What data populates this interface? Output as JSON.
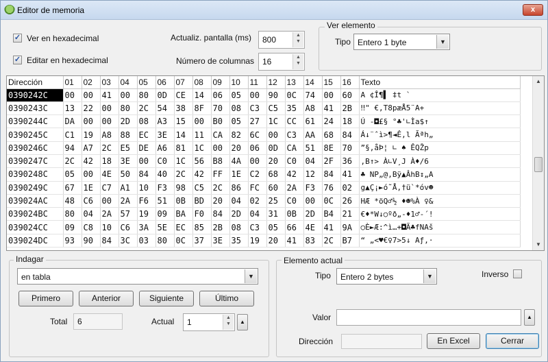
{
  "window": {
    "title": "Editor de memoria",
    "close": "x"
  },
  "options": {
    "hex_view_label": "Ver en hexadecimal",
    "hex_view_checked": true,
    "hex_edit_label": "Editar en hexadecimal",
    "hex_edit_checked": true,
    "refresh_label": "Actualiz. pantalla (ms)",
    "refresh_value": "800",
    "columns_label": "Número de columnas",
    "columns_value": "16"
  },
  "view_element": {
    "title": "Ver elemento",
    "type_label": "Tipo",
    "type_value": "Entero 1 byte"
  },
  "grid": {
    "headers": [
      "Dirección",
      "01",
      "02",
      "03",
      "04",
      "05",
      "06",
      "07",
      "08",
      "09",
      "10",
      "11",
      "12",
      "13",
      "14",
      "15",
      "16",
      "Texto"
    ],
    "rows": [
      {
        "addr": "0390242C",
        "bytes": [
          "00",
          "00",
          "41",
          "00",
          "80",
          "0D",
          "CE",
          "14",
          "06",
          "05",
          "00",
          "90",
          "0C",
          "74",
          "00",
          "60"
        ],
        "text": "  A ¢Î¶▌ ‡t `"
      },
      {
        "addr": "0390243C",
        "bytes": [
          "13",
          "22",
          "00",
          "80",
          "2C",
          "54",
          "38",
          "8F",
          "70",
          "08",
          "C3",
          "C5",
          "35",
          "A8",
          "41",
          "2B"
        ],
        "text": "‼\" €,T8pæÅ5¨A+"
      },
      {
        "addr": "0390244C",
        "bytes": [
          "DA",
          "00",
          "00",
          "2D",
          "08",
          "A3",
          "15",
          "00",
          "B0",
          "05",
          "27",
          "1C",
          "CC",
          "61",
          "24",
          "18"
        ],
        "text": "Ú  -◘£§ °♣'∟Ìa$↑"
      },
      {
        "addr": "0390245C",
        "bytes": [
          "C1",
          "19",
          "A8",
          "88",
          "EC",
          "3E",
          "14",
          "11",
          "CA",
          "82",
          "6C",
          "00",
          "C3",
          "AA",
          "68",
          "84"
        ],
        "text": "Á↓¨ˆì>¶◄Ê‚l Ãªh„"
      },
      {
        "addr": "0390246C",
        "bytes": [
          "94",
          "A7",
          "2C",
          "E5",
          "DE",
          "A6",
          "81",
          "1C",
          "00",
          "20",
          "06",
          "0D",
          "CA",
          "51",
          "8E",
          "70"
        ],
        "text": "”§,åÞ¦ ∟  ♠ ÊQŽp"
      },
      {
        "addr": "0390247C",
        "bytes": [
          "2C",
          "42",
          "18",
          "3E",
          "00",
          "C0",
          "1C",
          "56",
          "B8",
          "4A",
          "00",
          "20",
          "C0",
          "04",
          "2F",
          "36"
        ],
        "text": ",B↑> À∟V¸J  À♦/6"
      },
      {
        "addr": "0390248C",
        "bytes": [
          "05",
          "00",
          "4E",
          "50",
          "84",
          "40",
          "2C",
          "42",
          "FF",
          "1E",
          "C2",
          "68",
          "42",
          "12",
          "84",
          "41"
        ],
        "text": "♣ NP„@,Bÿ▲ÂhB↕„A"
      },
      {
        "addr": "0390249C",
        "bytes": [
          "67",
          "1E",
          "C7",
          "A1",
          "10",
          "F3",
          "98",
          "C5",
          "2C",
          "86",
          "FC",
          "60",
          "2A",
          "F3",
          "76",
          "02"
        ],
        "text": "g▲Ç¡►ó˜Å,†ü`*óv☻"
      },
      {
        "addr": "039024AC",
        "bytes": [
          "48",
          "C6",
          "00",
          "2A",
          "F6",
          "51",
          "0B",
          "BD",
          "20",
          "04",
          "02",
          "25",
          "C0",
          "00",
          "0C",
          "26"
        ],
        "text": "HÆ *öQ♂½ ♦☻%À ♀&"
      },
      {
        "addr": "039024BC",
        "bytes": [
          "80",
          "04",
          "2A",
          "57",
          "19",
          "09",
          "BA",
          "F0",
          "84",
          "2D",
          "04",
          "31",
          "0B",
          "2D",
          "B4",
          "21"
        ],
        "text": "€♦*W↓○ºð„-♦1♂-´!"
      },
      {
        "addr": "039024CC",
        "bytes": [
          "09",
          "C8",
          "10",
          "C6",
          "3A",
          "5E",
          "EC",
          "85",
          "2B",
          "08",
          "C3",
          "05",
          "66",
          "4E",
          "41",
          "9A"
        ],
        "text": "○È►Æ:^ì…+◘Ã♣fNAš"
      },
      {
        "addr": "039024DC",
        "bytes": [
          "93",
          "90",
          "84",
          "3C",
          "03",
          "80",
          "0C",
          "37",
          "3E",
          "35",
          "19",
          "20",
          "41",
          "83",
          "2C",
          "B7"
        ],
        "text": "“ „<♥€♀7>5↓ Aƒ,·"
      }
    ]
  },
  "search": {
    "title": "Indagar",
    "mode": "en tabla",
    "first": "Primero",
    "prev": "Anterior",
    "next": "Siguiente",
    "last": "Último",
    "total_label": "Total",
    "total_value": "6",
    "current_label": "Actual",
    "current_value": "1"
  },
  "current_element": {
    "title": "Elemento actual",
    "type_label": "Tipo",
    "type_value": "Entero 2 bytes",
    "inverse_label": "Inverso",
    "value_label": "Valor",
    "value": "",
    "address_label": "Dirección",
    "address": "",
    "excel_button": "En Excel",
    "close_button": "Cerrar"
  }
}
